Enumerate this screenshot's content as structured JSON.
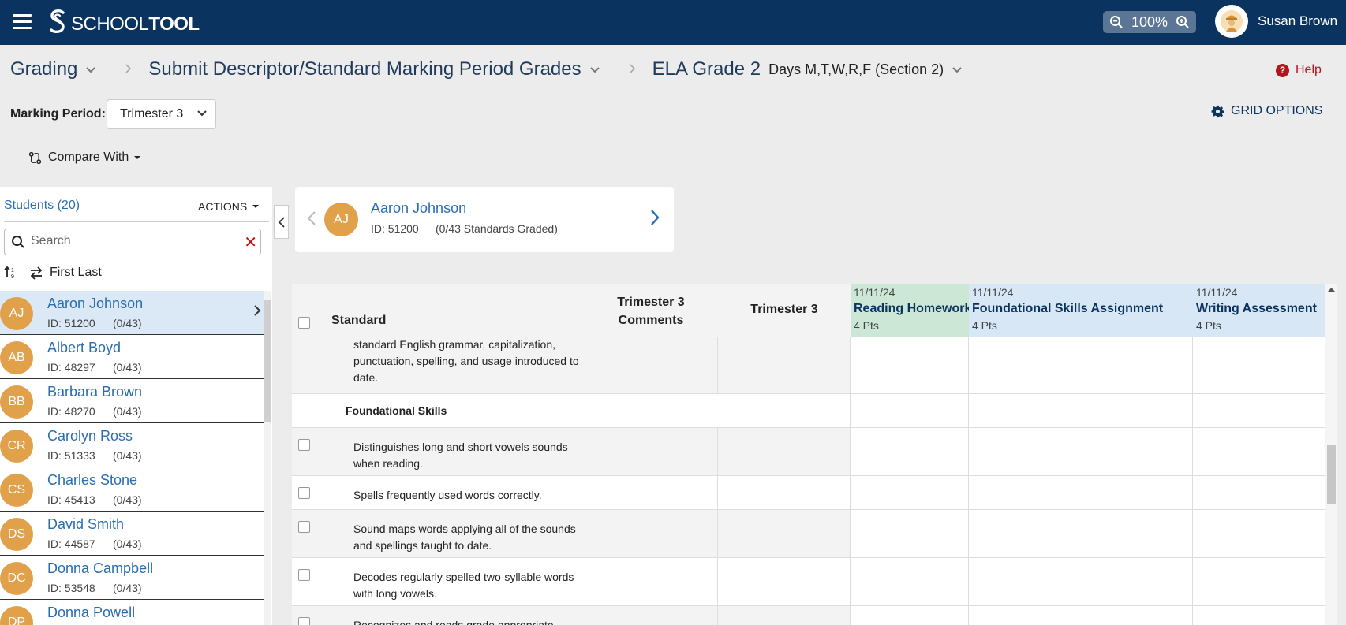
{
  "app": {
    "brand_prefix": "SCHOOL",
    "brand_suffix": "TOOL",
    "zoom_level": "100%",
    "user_name": "Susan Brown"
  },
  "breadcrumb": {
    "level1": "Grading",
    "level2": "Submit Descriptor/Standard Marking Period Grades",
    "level3": "ELA Grade 2",
    "level3_detail": "Days M,T,W,R,F (Section 2)"
  },
  "help_label": "Help",
  "marking_period": {
    "label": "Marking Period:",
    "value": "Trimester 3"
  },
  "grid_options_label": "GRID OPTIONS",
  "compare_label": "Compare With",
  "students_panel": {
    "header": "Students (20)",
    "actions_label": "ACTIONS",
    "search_placeholder": "Search",
    "sort_label": "First Last",
    "students": [
      {
        "initials": "AJ",
        "name": "Aaron Johnson",
        "id": "ID: 51200",
        "count": "(0/43)"
      },
      {
        "initials": "AB",
        "name": "Albert Boyd",
        "id": "ID: 48297",
        "count": "(0/43)"
      },
      {
        "initials": "BB",
        "name": "Barbara Brown",
        "id": "ID: 48270",
        "count": "(0/43)"
      },
      {
        "initials": "CR",
        "name": "Carolyn Ross",
        "id": "ID: 51333",
        "count": "(0/43)"
      },
      {
        "initials": "CS",
        "name": "Charles Stone",
        "id": "ID: 45413",
        "count": "(0/43)"
      },
      {
        "initials": "DS",
        "name": "David Smith",
        "id": "ID: 44587",
        "count": "(0/43)"
      },
      {
        "initials": "DC",
        "name": "Donna Campbell",
        "id": "ID: 53548",
        "count": "(0/43)"
      },
      {
        "initials": "DP",
        "name": "Donna Powell",
        "id": "",
        "count": ""
      }
    ]
  },
  "student_card": {
    "initials": "AJ",
    "name": "Aaron Johnson",
    "id": "ID: 51200",
    "graded": "(0/43 Standards Graded)"
  },
  "grid": {
    "standard_header": "Standard",
    "comments_header_1": "Trimester 3",
    "comments_header_2": "Comments",
    "trimester_header": "Trimester 3",
    "assignments": [
      {
        "date": "11/11/24",
        "title": "Reading Homework",
        "points": "4 Pts"
      },
      {
        "date": "11/11/24",
        "title": "Foundational Skills Assignment",
        "points": "4 Pts"
      },
      {
        "date": "11/11/24",
        "title": "Writing Assessment",
        "points": "4 Pts"
      }
    ],
    "rows": [
      {
        "type": "standard",
        "text": "standard English grammar, capitalization, punctuation, spelling, and usage introduced to date."
      },
      {
        "type": "category",
        "text": "Foundational Skills"
      },
      {
        "type": "standard",
        "text": "Distinguishes long and short vowels sounds when reading."
      },
      {
        "type": "standard",
        "text": "Spells frequently used words correctly."
      },
      {
        "type": "standard",
        "text": "Sound maps words applying all of the sounds and spellings taught to date."
      },
      {
        "type": "standard",
        "text": "Decodes regularly spelled two-syllable words with long vowels."
      },
      {
        "type": "standard",
        "text": "Recognizes and reads grade appropriate"
      }
    ]
  },
  "colors": {
    "topbar": "#0b3360",
    "link_blue": "#2a6db0",
    "avatar_orange": "#e1a04a",
    "help_red": "#b4141b",
    "reading_header_green": "#cce7d6",
    "assignment_header_blue": "#d7e7f5"
  }
}
